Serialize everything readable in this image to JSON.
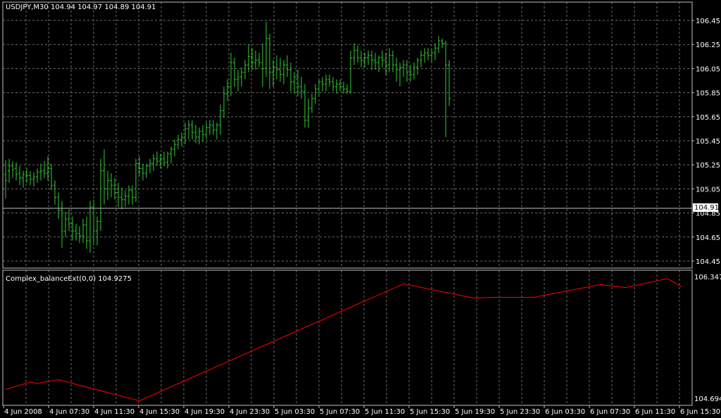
{
  "header": {
    "symbol_tf": "USDJPY,M30",
    "ohlc": "104.94 104.97 104.89 104.91"
  },
  "indicator": {
    "label": "Complex_balanceExt(0,0) 104.9275",
    "scale_top": "106.3478",
    "scale_bottom": "104.6949"
  },
  "colors": {
    "background": "#000000",
    "grid": "#6b6b6b",
    "bars": "#33cc33",
    "indicator": "#ff0000",
    "axis_text": "#ffffff",
    "separator": "#c0c0c0"
  },
  "current_price_label": "104.91",
  "chart_data": [
    {
      "type": "ohlc",
      "title": "USDJPY,M30",
      "y_ticks": [
        "106.45",
        "106.25",
        "106.05",
        "105.85",
        "105.65",
        "105.45",
        "105.25",
        "105.05",
        "104.85",
        "104.65",
        "104.45"
      ],
      "ylim": [
        104.43,
        106.52
      ],
      "x_ticks": [
        "4 Jun 2008",
        "4 Jun 07:30",
        "4 Jun 11:30",
        "4 Jun 15:30",
        "4 Jun 19:30",
        "4 Jun 23:30",
        "5 Jun 03:30",
        "5 Jun 07:30",
        "5 Jun 11:30",
        "5 Jun 15:30",
        "5 Jun 19:30",
        "5 Jun 23:30",
        "6 Jun 03:30",
        "6 Jun 07:30",
        "6 Jun 11:30",
        "6 Jun 15:30"
      ],
      "grid": true,
      "bars": [
        [
          105.17,
          105.29,
          104.97,
          105.12
        ],
        [
          105.2,
          105.3,
          105.1,
          105.24
        ],
        [
          105.24,
          105.28,
          105.14,
          105.21
        ],
        [
          105.22,
          105.27,
          105.12,
          105.17
        ],
        [
          105.18,
          105.24,
          105.08,
          105.14
        ],
        [
          105.14,
          105.2,
          105.06,
          105.17
        ],
        [
          105.17,
          105.22,
          105.1,
          105.16
        ],
        [
          105.16,
          105.2,
          105.08,
          105.13
        ],
        [
          105.13,
          105.19,
          105.07,
          105.15
        ],
        [
          105.15,
          105.22,
          105.1,
          105.19
        ],
        [
          105.19,
          105.26,
          105.12,
          105.2
        ],
        [
          105.2,
          105.28,
          105.14,
          105.18
        ],
        [
          105.18,
          105.32,
          105.12,
          105.22
        ],
        [
          105.22,
          105.26,
          105.04,
          105.08
        ],
        [
          105.08,
          105.12,
          104.92,
          104.98
        ],
        [
          104.98,
          105.02,
          104.8,
          104.87
        ],
        [
          104.87,
          104.95,
          104.56,
          104.7
        ],
        [
          104.7,
          104.86,
          104.65,
          104.8
        ],
        [
          104.8,
          104.88,
          104.7,
          104.76
        ],
        [
          104.76,
          104.82,
          104.62,
          104.7
        ],
        [
          104.7,
          104.76,
          104.62,
          104.68
        ],
        [
          104.68,
          104.74,
          104.6,
          104.66
        ],
        [
          104.66,
          104.8,
          104.6,
          104.75
        ],
        [
          104.75,
          104.82,
          104.55,
          104.62
        ],
        [
          104.62,
          104.95,
          104.52,
          104.9
        ],
        [
          104.9,
          104.96,
          104.58,
          104.7
        ],
        [
          104.7,
          104.82,
          104.58,
          104.78
        ],
        [
          104.78,
          105.3,
          104.7,
          105.2
        ],
        [
          105.2,
          105.38,
          104.92,
          105.05
        ],
        [
          105.05,
          105.2,
          104.96,
          105.12
        ],
        [
          105.12,
          105.18,
          104.98,
          105.08
        ],
        [
          105.08,
          105.14,
          104.96,
          105.02
        ],
        [
          105.02,
          105.1,
          104.9,
          104.98
        ],
        [
          104.98,
          105.06,
          104.88,
          104.96
        ],
        [
          104.96,
          105.04,
          104.9,
          104.99
        ],
        [
          104.99,
          105.08,
          104.92,
          105.04
        ],
        [
          105.04,
          105.08,
          104.92,
          104.98
        ],
        [
          104.98,
          105.3,
          104.94,
          105.26
        ],
        [
          105.26,
          105.32,
          105.16,
          105.22
        ],
        [
          105.22,
          105.26,
          105.12,
          105.18
        ],
        [
          105.18,
          105.26,
          105.14,
          105.24
        ],
        [
          105.24,
          105.3,
          105.18,
          105.26
        ],
        [
          105.26,
          105.34,
          105.2,
          105.3
        ],
        [
          105.3,
          105.36,
          105.24,
          105.28
        ],
        [
          105.28,
          105.34,
          105.22,
          105.3
        ],
        [
          105.3,
          105.36,
          105.24,
          105.27
        ],
        [
          105.27,
          105.36,
          105.22,
          105.34
        ],
        [
          105.34,
          105.4,
          105.26,
          105.38
        ],
        [
          105.38,
          105.46,
          105.32,
          105.42
        ],
        [
          105.42,
          105.5,
          105.38,
          105.46
        ],
        [
          105.46,
          105.52,
          105.4,
          105.48
        ],
        [
          105.48,
          105.6,
          105.42,
          105.55
        ],
        [
          105.55,
          105.62,
          105.46,
          105.58
        ],
        [
          105.58,
          105.62,
          105.46,
          105.52
        ],
        [
          105.52,
          105.58,
          105.43,
          105.48
        ],
        [
          105.48,
          105.56,
          105.42,
          105.53
        ],
        [
          105.53,
          105.58,
          105.44,
          105.5
        ],
        [
          105.5,
          105.6,
          105.46,
          105.56
        ],
        [
          105.56,
          105.62,
          105.5,
          105.58
        ],
        [
          105.58,
          105.62,
          105.5,
          105.54
        ],
        [
          105.54,
          105.6,
          105.46,
          105.58
        ],
        [
          105.58,
          105.75,
          105.5,
          105.7
        ],
        [
          105.7,
          105.9,
          105.64,
          105.84
        ],
        [
          105.84,
          105.96,
          105.78,
          105.9
        ],
        [
          105.9,
          106.18,
          105.82,
          106.1
        ],
        [
          106.1,
          106.14,
          105.9,
          105.96
        ],
        [
          105.96,
          106.04,
          105.86,
          105.98
        ],
        [
          105.98,
          106.06,
          105.9,
          106.02
        ],
        [
          106.02,
          106.12,
          105.96,
          106.08
        ],
        [
          106.08,
          106.25,
          106.02,
          106.15
        ],
        [
          106.15,
          106.22,
          106.04,
          106.1
        ],
        [
          106.1,
          106.2,
          106.04,
          106.12
        ],
        [
          106.12,
          106.18,
          106.06,
          106.1
        ],
        [
          106.1,
          106.26,
          105.9,
          106.05
        ],
        [
          106.05,
          106.44,
          105.98,
          106.3
        ],
        [
          106.3,
          106.34,
          105.88,
          106.02
        ],
        [
          106.02,
          106.12,
          105.9,
          106.06
        ],
        [
          106.06,
          106.16,
          105.96,
          106.04
        ],
        [
          106.04,
          106.14,
          105.94,
          106.0
        ],
        [
          106.0,
          106.12,
          105.92,
          106.08
        ],
        [
          106.08,
          106.16,
          105.98,
          106.04
        ],
        [
          106.04,
          106.1,
          105.86,
          105.94
        ],
        [
          105.94,
          106.02,
          105.84,
          105.98
        ],
        [
          105.98,
          106.04,
          105.82,
          105.9
        ],
        [
          105.9,
          105.98,
          105.8,
          105.86
        ],
        [
          105.86,
          105.92,
          105.56,
          105.62
        ],
        [
          105.62,
          105.8,
          105.56,
          105.72
        ],
        [
          105.72,
          105.84,
          105.68,
          105.8
        ],
        [
          105.8,
          105.92,
          105.76,
          105.88
        ],
        [
          105.88,
          105.96,
          105.82,
          105.94
        ],
        [
          105.94,
          105.98,
          105.86,
          105.92
        ],
        [
          105.92,
          106.0,
          105.86,
          105.96
        ],
        [
          105.96,
          106.0,
          105.9,
          105.94
        ],
        [
          105.94,
          105.98,
          105.86,
          105.9
        ],
        [
          105.9,
          105.96,
          105.84,
          105.92
        ],
        [
          105.92,
          105.96,
          105.86,
          105.9
        ],
        [
          105.9,
          105.94,
          105.84,
          105.88
        ],
        [
          105.88,
          105.92,
          105.84,
          105.86
        ],
        [
          105.86,
          106.2,
          105.84,
          106.14
        ],
        [
          106.14,
          106.26,
          106.08,
          106.2
        ],
        [
          106.2,
          106.24,
          106.1,
          106.14
        ],
        [
          106.14,
          106.2,
          106.06,
          106.12
        ],
        [
          106.12,
          106.18,
          106.06,
          106.14
        ],
        [
          106.14,
          106.2,
          106.08,
          106.16
        ],
        [
          106.16,
          106.2,
          106.04,
          106.12
        ],
        [
          106.12,
          106.18,
          106.04,
          106.1
        ],
        [
          106.1,
          106.16,
          106.02,
          106.14
        ],
        [
          106.14,
          106.2,
          106.06,
          106.12
        ],
        [
          106.12,
          106.18,
          106.0,
          106.08
        ],
        [
          106.08,
          106.22,
          106.02,
          106.16
        ],
        [
          106.16,
          106.2,
          106.02,
          106.08
        ],
        [
          106.08,
          106.14,
          105.94,
          106.04
        ],
        [
          106.04,
          106.1,
          105.9,
          106.06
        ],
        [
          106.06,
          106.12,
          105.98,
          106.08
        ],
        [
          106.08,
          106.12,
          105.94,
          106.02
        ],
        [
          106.02,
          106.08,
          105.94,
          106.0
        ],
        [
          106.0,
          106.1,
          105.96,
          106.06
        ],
        [
          106.06,
          106.14,
          106.0,
          106.12
        ],
        [
          106.12,
          106.2,
          106.06,
          106.16
        ],
        [
          106.16,
          106.22,
          106.1,
          106.18
        ],
        [
          106.18,
          106.22,
          106.12,
          106.16
        ],
        [
          106.16,
          106.22,
          106.1,
          106.18
        ],
        [
          106.18,
          106.26,
          106.12,
          106.22
        ],
        [
          106.22,
          106.32,
          106.18,
          106.28
        ],
        [
          106.28,
          106.3,
          106.22,
          106.26
        ],
        [
          106.26,
          106.28,
          105.48,
          106.08
        ],
        [
          106.08,
          106.12,
          105.74,
          105.8
        ]
      ]
    },
    {
      "type": "line",
      "title": "Complex_balanceExt(0,0)",
      "ylim": [
        104.6949,
        106.3478
      ],
      "series": [
        {
          "x": [
            0,
            7,
            9,
            11,
            15,
            38,
            113,
            133,
            138,
            150,
            169,
            176,
            188
          ],
          "y": [
            104.85,
            104.95,
            104.93,
            104.95,
            104.98,
            104.7,
            106.26,
            106.07,
            106.08,
            106.08,
            106.25,
            106.21,
            106.33
          ]
        },
        {
          "x": [
            188,
            192
          ],
          "y": [
            106.33,
            106.22
          ]
        }
      ]
    }
  ]
}
